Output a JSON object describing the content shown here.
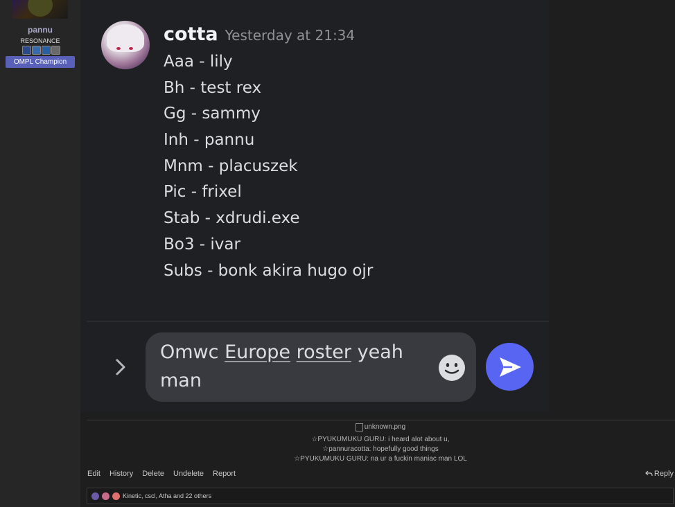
{
  "profile": {
    "username": "pannu",
    "title": "RESONANCE",
    "badge": "OMPL Champion",
    "icons": [
      "award-icon-1",
      "award-icon-2",
      "award-icon-3",
      "award-icon-4"
    ]
  },
  "message": {
    "author": "cotta",
    "timestamp": "Yesterday at 21:34",
    "lines": [
      "Aaa - lily",
      "Bh - test rex",
      "Gg - sammy",
      "Inh - pannu",
      "Mnm - placuszek",
      "Pic - frixel",
      "Stab - xdrudi.exe",
      "Bo3 - ivar",
      "Subs - bonk akira hugo ojr"
    ]
  },
  "composer": {
    "text_before": "Omwc ",
    "word1": "Europe",
    "space": " ",
    "word2": "roster",
    "text_after": " yeah man"
  },
  "caption": {
    "image_alt": "unknown.png",
    "lines": [
      "☆PYUKUMUKU GURU: i heard alot about u,",
      "☆pannuracotta: hopefully good things",
      "☆PYUKUMUKU GURU: na ur a fuckin maniac man LOL"
    ]
  },
  "actions": {
    "edit": "Edit",
    "history": "History",
    "delete": "Delete",
    "undelete": "Undelete",
    "report": "Report",
    "reply": "Reply"
  },
  "reactions": {
    "text": "Kinetic, cscl, Atha and 22 others"
  },
  "colors": {
    "accent": "#5865f2",
    "badge": "#5960b8"
  }
}
